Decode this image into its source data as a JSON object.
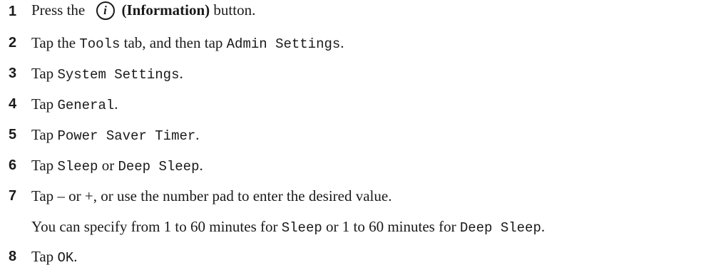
{
  "steps": [
    {
      "n": "1",
      "parts": [
        {
          "t": "Press the ",
          "c": ""
        },
        {
          "icon": "information-icon",
          "glyph": "i"
        },
        {
          "t": "(Information)",
          "c": "bold"
        },
        {
          "t": " button.",
          "c": ""
        }
      ]
    },
    {
      "n": "2",
      "parts": [
        {
          "t": "Tap the ",
          "c": ""
        },
        {
          "t": "Tools",
          "c": "mono"
        },
        {
          "t": " tab, and then tap ",
          "c": ""
        },
        {
          "t": "Admin Settings",
          "c": "mono"
        },
        {
          "t": ".",
          "c": ""
        }
      ]
    },
    {
      "n": "3",
      "parts": [
        {
          "t": "Tap ",
          "c": ""
        },
        {
          "t": "System Settings",
          "c": "mono"
        },
        {
          "t": ".",
          "c": ""
        }
      ]
    },
    {
      "n": "4",
      "parts": [
        {
          "t": "Tap ",
          "c": ""
        },
        {
          "t": "General",
          "c": "mono"
        },
        {
          "t": ".",
          "c": ""
        }
      ]
    },
    {
      "n": "5",
      "parts": [
        {
          "t": "Tap ",
          "c": ""
        },
        {
          "t": "Power Saver Timer",
          "c": "mono"
        },
        {
          "t": ".",
          "c": ""
        }
      ]
    },
    {
      "n": "6",
      "parts": [
        {
          "t": "Tap ",
          "c": ""
        },
        {
          "t": "Sleep",
          "c": "mono"
        },
        {
          "t": " or ",
          "c": ""
        },
        {
          "t": "Deep Sleep",
          "c": "mono"
        },
        {
          "t": ".",
          "c": ""
        }
      ]
    },
    {
      "n": "7",
      "parts": [
        {
          "t": "Tap – or +, or use the number pad to enter the desired value.",
          "c": ""
        }
      ]
    },
    {
      "n": "",
      "parts": [
        {
          "t": "You can specify from 1 to 60 minutes for ",
          "c": ""
        },
        {
          "t": "Sleep",
          "c": "mono"
        },
        {
          "t": " or 1 to 60 minutes for ",
          "c": ""
        },
        {
          "t": "Deep Sleep",
          "c": "mono"
        },
        {
          "t": ".",
          "c": ""
        }
      ]
    },
    {
      "n": "8",
      "parts": [
        {
          "t": "Tap ",
          "c": ""
        },
        {
          "t": "OK",
          "c": "mono"
        },
        {
          "t": ".",
          "c": ""
        }
      ]
    }
  ]
}
